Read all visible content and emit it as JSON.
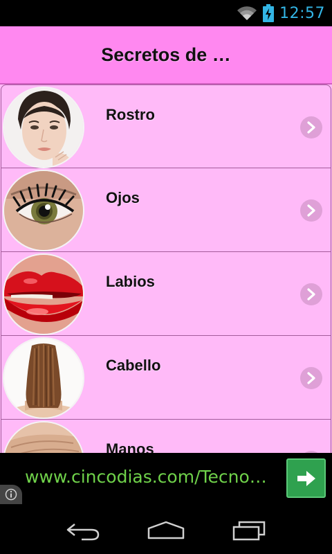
{
  "status_bar": {
    "time": "12:57",
    "time_color": "#33b5e5",
    "icons": [
      "wifi-icon",
      "battery-charging-icon"
    ]
  },
  "action_bar": {
    "title": "Secretos de …",
    "background": "#ff88f0"
  },
  "list": {
    "background": "#ffbaf8",
    "items": [
      {
        "label": "Rostro",
        "icon": "face-thumbnail",
        "trailing_icon": "chevron-right-icon"
      },
      {
        "label": "Ojos",
        "icon": "eye-thumbnail",
        "trailing_icon": "chevron-right-icon"
      },
      {
        "label": "Labios",
        "icon": "lips-thumbnail",
        "trailing_icon": "chevron-right-icon"
      },
      {
        "label": "Cabello",
        "icon": "hair-thumbnail",
        "trailing_icon": "chevron-right-icon"
      },
      {
        "label": "Manos",
        "icon": "hands-thumbnail",
        "trailing_icon": "chevron-right-icon"
      }
    ]
  },
  "ad": {
    "text": "www.cincodias.com/Tecnol...",
    "text_color": "#6fd14a",
    "button_icon": "arrow-right-icon",
    "button_color": "#2fa14f",
    "info_icon": "info-icon"
  },
  "nav_bar": {
    "buttons": [
      "back-icon",
      "home-icon",
      "recents-icon"
    ]
  }
}
